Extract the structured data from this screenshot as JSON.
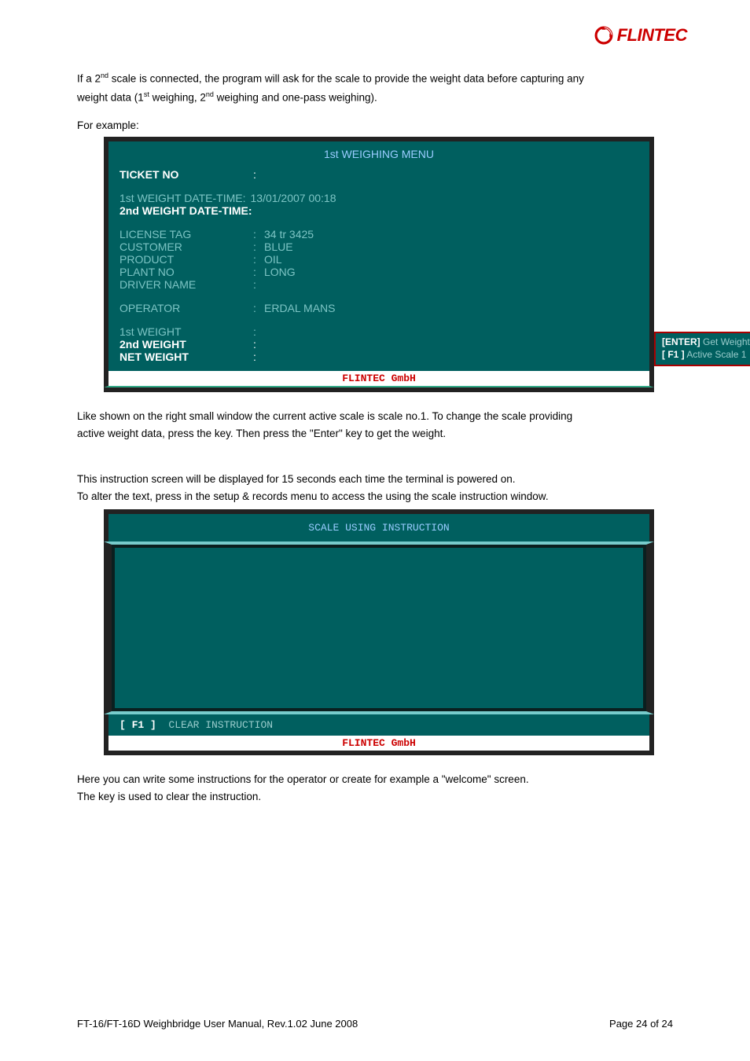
{
  "brand": "FLINTEC",
  "intro": {
    "line1a": "If a 2",
    "sup_nd": "nd",
    "line1b": " scale is connected, the program will ask for the scale to provide the weight data before capturing any",
    "line2a": "weight data (1",
    "sup_st": "st",
    "line2b": " weighing, 2",
    "line2c": " weighing and one-pass weighing).",
    "for_example": "For example:"
  },
  "term1": {
    "title": "1st WEIGHING MENU",
    "rows": {
      "ticket_no_label": "TICKET NO",
      "first_dt_label": "1st WEIGHT DATE-TIME:",
      "first_dt_value": "13/01/2007 00:18",
      "second_dt_label": "2nd WEIGHT DATE-TIME:",
      "license_tag_label": "LICENSE TAG",
      "license_tag_value": "34 tr 3425",
      "customer_label": "CUSTOMER",
      "customer_value": "BLUE",
      "product_label": "PRODUCT",
      "product_value": "OIL",
      "plant_no_label": "PLANT NO",
      "plant_no_value": "LONG",
      "driver_name_label": "DRIVER NAME",
      "operator_label": "OPERATOR",
      "operator_value": "ERDAL MANS",
      "first_weight_label": "1st WEIGHT",
      "second_weight_label": "2nd WEIGHT",
      "net_weight_label": "NET WEIGHT"
    },
    "side": {
      "enter_key": "[ENTER]",
      "enter_text": "Get Weight",
      "f1_key": "[ F1 ]",
      "f1_text": "Active Scale 1"
    },
    "footer": "FLINTEC GmbH"
  },
  "mid_text": {
    "p1": "Like shown on the right small window the current active scale is scale no.1. To change the scale providing",
    "p2a": "active weight data, press the ",
    "p2b": " key. Then press the \"Enter\" key to get the weight.",
    "p3": "This instruction screen will be displayed for 15 seconds each time the terminal is powered on.",
    "p4a": "To alter the text, press ",
    "p4b": " in the setup & records menu to access the using the scale instruction window."
  },
  "term2": {
    "title": "SCALE USING INSTRUCTION",
    "f1_key": "[ F1 ]",
    "f1_text": "CLEAR INSTRUCTION",
    "footer": "FLINTEC GmbH"
  },
  "after_term2": {
    "p1": "Here you can write some instructions for the operator or create for example a \"welcome\" screen.",
    "p2a": "The ",
    "p2b": " key is used to clear the instruction."
  },
  "footer": {
    "left": "FT-16/FT-16D Weighbridge User Manual, Rev.1.02   June 2008",
    "right": "Page 24 of 24"
  }
}
